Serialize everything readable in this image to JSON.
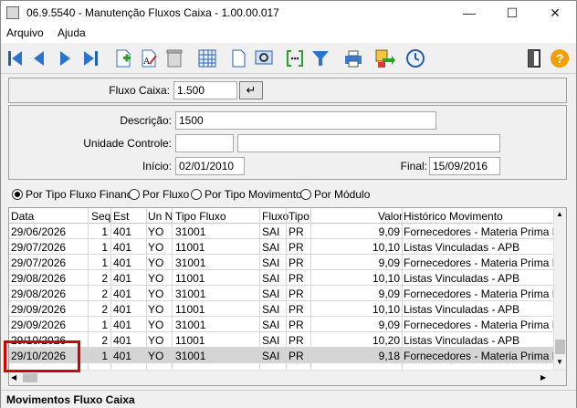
{
  "window": {
    "title": "06.9.5540 - Manutenção Fluxos Caixa - 1.00.00.017",
    "minimize": "—",
    "maximize": "☐",
    "close": "✕"
  },
  "menu": {
    "items": [
      "Arquivo",
      "Ajuda"
    ]
  },
  "toolbar": {
    "icons": [
      "first-record-icon",
      "prev-record-icon",
      "next-record-icon",
      "last-record-icon",
      "new-record-icon",
      "edit-record-icon",
      "delete-record-icon",
      "calendar-grid-icon",
      "document-icon",
      "preview-icon",
      "bracket-icon",
      "filter-icon",
      "print-icon",
      "export-icon",
      "clock-icon",
      "exit-icon",
      "help-icon"
    ],
    "help_label": "?"
  },
  "filter": {
    "fluxo_caixa_label": "Fluxo Caixa:",
    "fluxo_caixa_value": "1.500",
    "enter_label": "↵"
  },
  "details": {
    "descricao_label": "Descrição:",
    "descricao_value": "1500",
    "unidade_label": "Unidade Controle:",
    "unidade_code": "",
    "unidade_name": "",
    "inicio_label": "Início:",
    "inicio_value": "02/01/2010",
    "final_label": "Final:",
    "final_value": "15/09/2016"
  },
  "radios": {
    "options": [
      "Por Tipo Fluxo Financ",
      "Por Fluxo",
      "Por Tipo Movimento",
      "Por Módulo"
    ],
    "selected": 0
  },
  "grid": {
    "headers": [
      "Data",
      "Seq",
      "Est",
      "Un N",
      "Tipo Fluxo",
      "Fluxo",
      "Tipo",
      "Valor",
      "Histórico Movimento"
    ],
    "rows": [
      [
        "29/06/2026",
        "1",
        "401",
        "YO",
        "31001",
        "SAI",
        "PR",
        "9,09",
        "Fornecedores - Materia Prima Nac"
      ],
      [
        "29/07/2026",
        "1",
        "401",
        "YO",
        "11001",
        "SAI",
        "PR",
        "10,10",
        "Listas Vinculadas - APB"
      ],
      [
        "29/07/2026",
        "1",
        "401",
        "YO",
        "31001",
        "SAI",
        "PR",
        "9,09",
        "Fornecedores - Materia Prima Nac"
      ],
      [
        "29/08/2026",
        "2",
        "401",
        "YO",
        "11001",
        "SAI",
        "PR",
        "10,10",
        "Listas Vinculadas - APB"
      ],
      [
        "29/08/2026",
        "2",
        "401",
        "YO",
        "31001",
        "SAI",
        "PR",
        "9,09",
        "Fornecedores - Materia Prima Nac"
      ],
      [
        "29/09/2026",
        "2",
        "401",
        "YO",
        "11001",
        "SAI",
        "PR",
        "10,10",
        "Listas Vinculadas - APB"
      ],
      [
        "29/09/2026",
        "1",
        "401",
        "YO",
        "31001",
        "SAI",
        "PR",
        "9,09",
        "Fornecedores - Materia Prima Nac"
      ],
      [
        "29/10/2026",
        "2",
        "401",
        "YO",
        "11001",
        "SAI",
        "PR",
        "10,20",
        "Listas Vinculadas - APB"
      ],
      [
        "29/10/2026",
        "1",
        "401",
        "YO",
        "31001",
        "SAI",
        "PR",
        "9,18",
        "Fornecedores - Materia Prima Nac"
      ]
    ],
    "selected_row": 8
  },
  "status": {
    "text": "Movimentos Fluxo Caixa"
  },
  "colors": {
    "highlight": "#d40000",
    "selected_row": "#d4d4d4"
  }
}
